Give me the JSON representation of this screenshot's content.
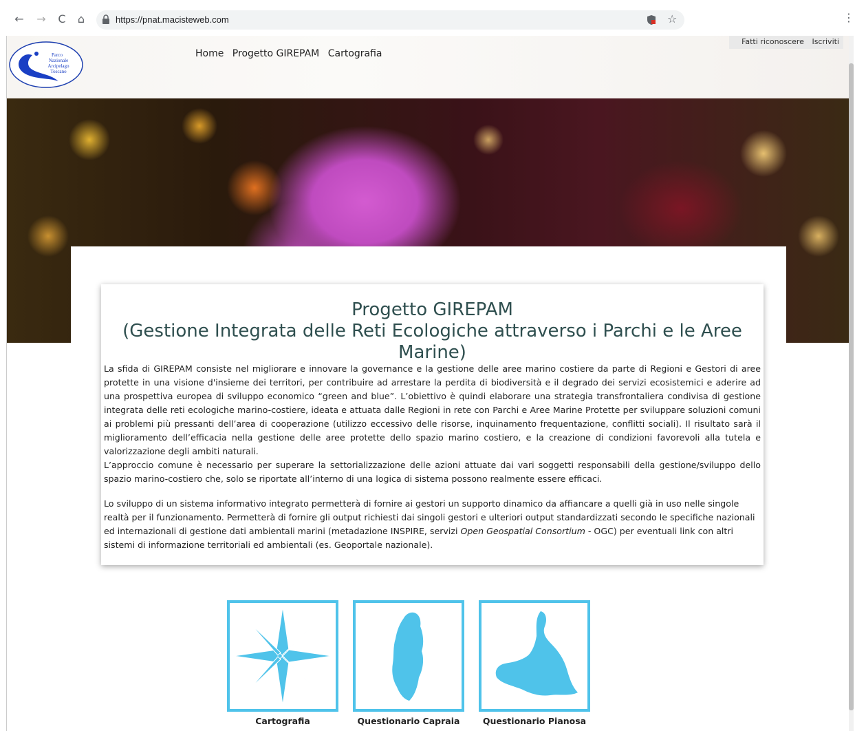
{
  "browser": {
    "url": "https://pnat.macisteweb.com",
    "back_icon": "←",
    "forward_icon": "→",
    "reload_icon": "C",
    "home_icon": "⌂",
    "star_icon": "☆",
    "menu_icon": "⋮"
  },
  "header": {
    "logo_text": [
      "Parco",
      "Nazionale",
      "Arcipelago",
      "Toscano"
    ],
    "nav": [
      "Home",
      "Progetto GIREPAM",
      "Cartografia"
    ],
    "login": "Fatti riconoscere",
    "register": "Iscriviti"
  },
  "article": {
    "title_line1": "Progetto GIREPAM",
    "title_line2": "(Gestione Integrata delle Reti Ecologiche attraverso i Parchi e le Aree Marine)",
    "p1": "La sfida di GIREPAM consiste nel migliorare e innovare la governance e la gestione delle aree marino costiere da parte di Regioni e Gestori di aree protette in una visione d'insieme dei territori, per contribuire ad arrestare la perdita di biodiversità e il degrado dei servizi ecosistemici e aderire ad una prospettiva europea di sviluppo economico “green and blue”. L’obiettivo è quindi elaborare una strategia transfrontaliera condivisa di gestione integrata delle reti ecologiche marino-costiere, ideata e attuata dalle Regioni in rete con Parchi e Aree Marine Protette per sviluppare soluzioni comuni ai problemi più pressanti dell’area di cooperazione (utilizzo eccessivo delle risorse, inquinamento frequentazione, conflitti sociali). Il risultato sarà il miglioramento dell’efficacia nella gestione delle aree protette dello spazio marino costiero, e la creazione di condizioni favorevoli alla tutela e valorizzazione degli ambiti naturali.",
    "p1b": "L’approccio comune è necessario per superare la settorializzazione delle azioni attuate dai vari soggetti responsabili della gestione/sviluppo dello spazio marino-costiero che, solo se riportate all’interno di una logica di sistema possono realmente essere efficaci.",
    "p2_start": "Lo sviluppo di un sistema informativo integrato permetterà di fornire ai gestori un supporto dinamico da affiancare a quelli già in uso nelle singole realtà per il funzionamento. Permetterà di fornire gli output richiesti dai singoli gestori e ulteriori output standardizzati secondo le specifiche nazionali ed internazionali di gestione dati ambientali marini (metadazione INSPIRE, servizi ",
    "p2_italic": "Open Geospatial Consortium",
    "p2_end": " - OGC) per eventuali link con altri sistemi di informazione territoriali ed ambientali (es. Geoportale nazionale)."
  },
  "tiles": [
    {
      "label": "Cartografia",
      "icon": "compass-rose-icon"
    },
    {
      "label": "Questionario Capraia",
      "icon": "capraia-island-icon"
    },
    {
      "label": "Questionario Pianosa",
      "icon": "pianosa-island-icon"
    }
  ],
  "colors": {
    "accent": "#4fc3ea",
    "title": "#2f4f4f"
  }
}
